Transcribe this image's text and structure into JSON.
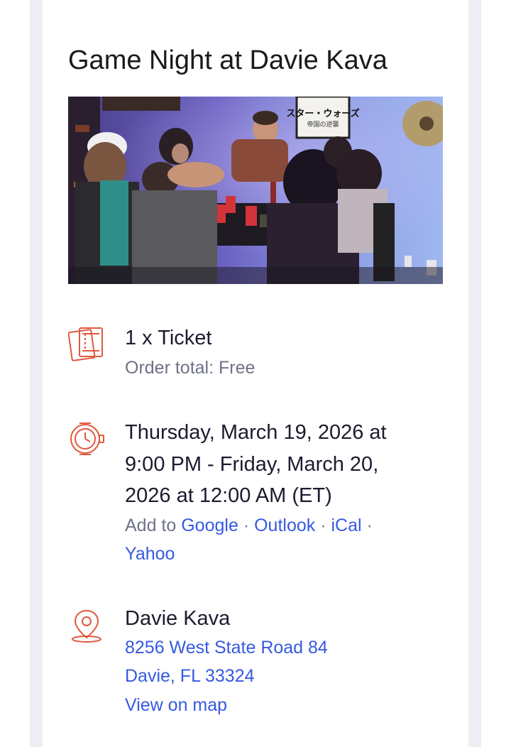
{
  "event": {
    "title": "Game Night at Davie Kava",
    "image_poster_text_line1": "スター・ウォーズ",
    "image_poster_text_line2": "帝国の逆襲"
  },
  "ticket": {
    "summary": "1 x Ticket",
    "order_total": "Order total: Free"
  },
  "datetime": {
    "line1": "Thursday, March 19, 2026 at",
    "line2": "9:00 PM - Friday, March 20,",
    "line3": "2026 at 12:00 AM (ET)",
    "add_to_label": "Add to",
    "calendars": [
      "Google",
      "Outlook",
      "iCal",
      "Yahoo"
    ],
    "separator": "·"
  },
  "location": {
    "venue": "Davie Kava",
    "address_line1": "8256 West State Road 84",
    "address_line2": "Davie, FL 33324",
    "map_link": "View on map"
  },
  "colors": {
    "accent_icon": "#e2583e",
    "link": "#3659e3",
    "secondary_text": "#6f7287",
    "gutter": "#eceef4"
  },
  "icons": {
    "ticket": "ticket-icon",
    "clock": "clock-icon",
    "location": "map-pin-icon"
  }
}
